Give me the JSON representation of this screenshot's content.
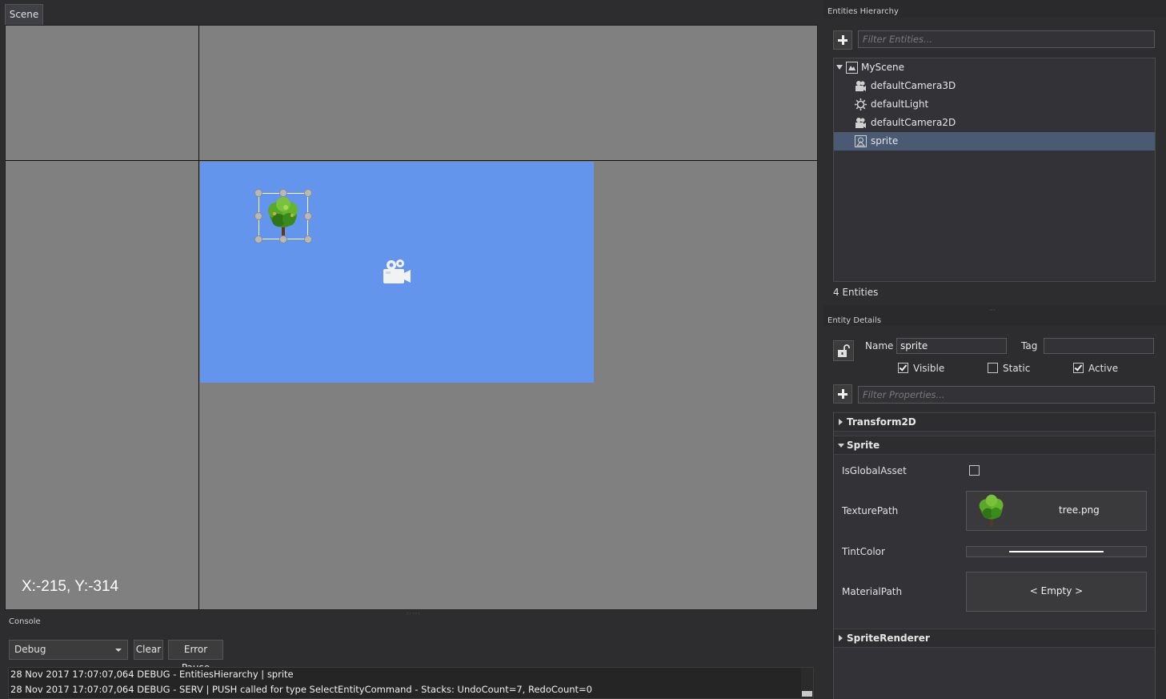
{
  "scene": {
    "tab_label": "Scene",
    "cursor_readout": "X:-215, Y:-314",
    "background_color": "#808080",
    "camera_area_color": "#6495ed"
  },
  "console": {
    "title": "Console",
    "level": "Debug",
    "clear_label": "Clear",
    "error_pause_label": "Error Pause",
    "lines": [
      "28 Nov 2017 17:07:07,064 DEBUG - EntitiesHierarchy | sprite",
      "28 Nov 2017 17:07:07,064 DEBUG - SERV   | PUSH called for type SelectEntityCommand - Stacks: UndoCount=7, RedoCount=0"
    ]
  },
  "hierarchy": {
    "title": "Entities Hierarchy",
    "filter_placeholder": "Filter Entities...",
    "root": "MyScene",
    "entities": [
      {
        "label": "defaultCamera3D",
        "icon": "camera-icon"
      },
      {
        "label": "defaultLight",
        "icon": "light-icon"
      },
      {
        "label": "defaultCamera2D",
        "icon": "camera-icon"
      },
      {
        "label": "sprite",
        "icon": "sprite-icon",
        "selected": true
      }
    ],
    "count_label": "4 Entities"
  },
  "details": {
    "title": "Entity Details",
    "name_label": "Name",
    "name_value": "sprite",
    "tag_label": "Tag",
    "tag_value": "",
    "visible_label": "Visible",
    "visible_checked": true,
    "static_label": "Static",
    "static_checked": false,
    "active_label": "Active",
    "active_checked": true,
    "filter_placeholder": "Filter Properties...",
    "components": {
      "transform": "Transform2D",
      "sprite": "Sprite",
      "renderer": "SpriteRenderer"
    },
    "sprite_props": {
      "is_global_asset_label": "IsGlobalAsset",
      "is_global_asset_checked": false,
      "texture_path_label": "TexturePath",
      "texture_path_value": "tree.png",
      "tint_color_label": "TintColor",
      "tint_color_value": "#ffffff",
      "material_path_label": "MaterialPath",
      "material_path_value": "< Empty >"
    }
  }
}
